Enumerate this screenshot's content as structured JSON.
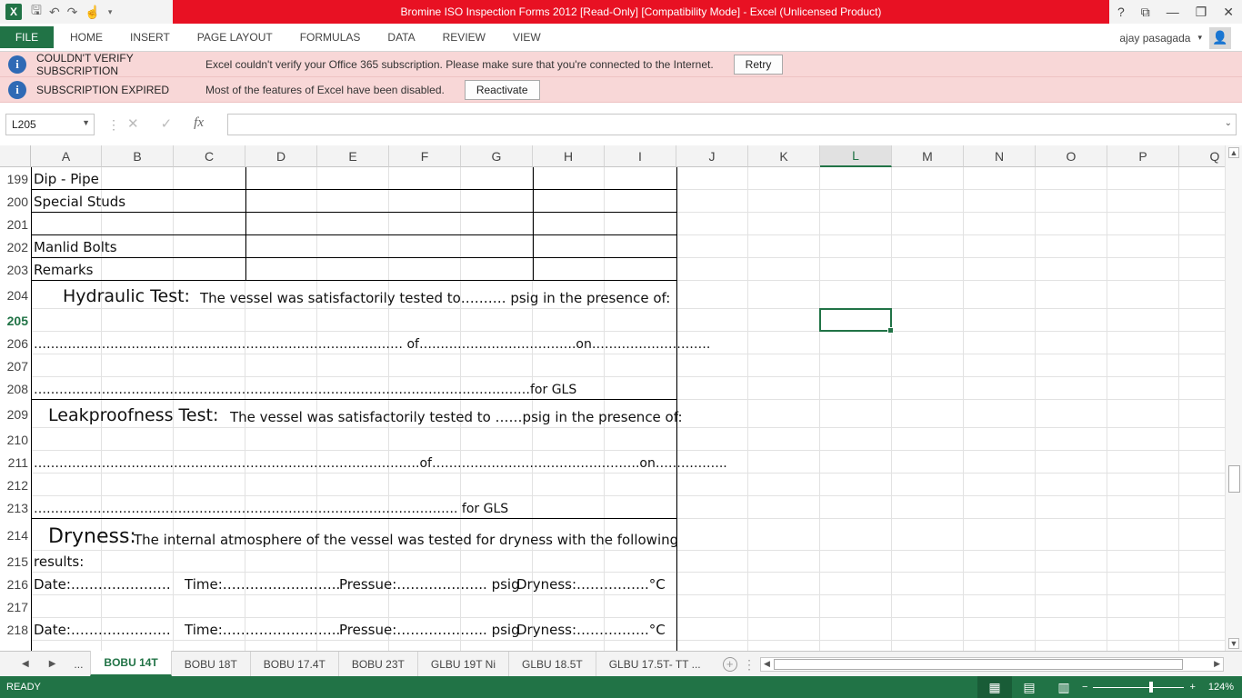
{
  "window": {
    "title": "Bromine ISO Inspection Forms 2012  [Read-Only]  [Compatibility Mode] -  Excel (Unlicensed Product)",
    "help": "?",
    "controls": [
      "⧉",
      "—",
      "❐",
      "✕"
    ]
  },
  "ribbon": {
    "file": "FILE",
    "tabs": [
      "HOME",
      "INSERT",
      "PAGE LAYOUT",
      "FORMULAS",
      "DATA",
      "REVIEW",
      "VIEW"
    ],
    "user": "ajay pasagada"
  },
  "messages": [
    {
      "title": "COULDN'T VERIFY SUBSCRIPTION",
      "text": "Excel couldn't verify your Office 365 subscription. Please make sure that you're connected to the Internet.",
      "button": "Retry"
    },
    {
      "title": "SUBSCRIPTION EXPIRED",
      "text": "Most of the features of Excel have been disabled.",
      "button": "Reactivate"
    }
  ],
  "formula_bar": {
    "name_box": "L205",
    "fx": "fx",
    "formula": ""
  },
  "grid": {
    "columns": [
      "A",
      "B",
      "C",
      "D",
      "E",
      "F",
      "G",
      "H",
      "I",
      "J",
      "K",
      "L",
      "M",
      "N",
      "O",
      "P",
      "Q"
    ],
    "selected_column": "L",
    "rows": [
      "199",
      "200",
      "201",
      "202",
      "203",
      "204",
      "205",
      "206",
      "207",
      "208",
      "209",
      "210",
      "211",
      "212",
      "213",
      "214",
      "215",
      "216",
      "217",
      "218"
    ],
    "selected_row": "205",
    "cells": {
      "r199": "Dip - Pipe",
      "r200": "Special Studs",
      "r202": "Manlid Bolts",
      "r203": "Remarks",
      "r204_title": "Hydraulic Test:",
      "r204_text": "The vessel was satisfactorily tested to………. psig in the presence of:",
      "r206": "…………………………………………………………………………… of……………………………….on……………………….",
      "r208": "………………………………………………………………………………………………………for GLS",
      "r209_title": "Leakproofness Test:",
      "r209_text": "The vessel was satisfactorily tested to ……psig in the presence of:",
      "r211": "……………………………………………………………………………….of………………………………………….on……………..",
      "r213": "………………………………………………………………………………………. for GLS",
      "r214_title": "Dryness:",
      "r214_text": "The internal atmosphere of the vessel was tested for dryness with the following",
      "r215": "results:",
      "r216": {
        "date": "Date:………………….",
        "time": "Time:……………………..",
        "pressue": "Pressue:……………….. psig",
        "dryness": "Dryness:…………….°C"
      },
      "r218": {
        "date": "Date:………………….",
        "time": "Time:……………………..",
        "pressue": "Pressue:……………….. psig",
        "dryness": "Dryness:…………….°C"
      }
    }
  },
  "sheet_tabs": {
    "more": "...",
    "tabs": [
      "BOBU 14T",
      "BOBU 18T",
      "BOBU 17.4T",
      "BOBU 23T",
      "GLBU 19T Ni",
      "GLBU 18.5T",
      "GLBU 17.5T- TT ..."
    ],
    "active": "BOBU 14T"
  },
  "status": {
    "ready": "READY",
    "zoom": "124%"
  }
}
